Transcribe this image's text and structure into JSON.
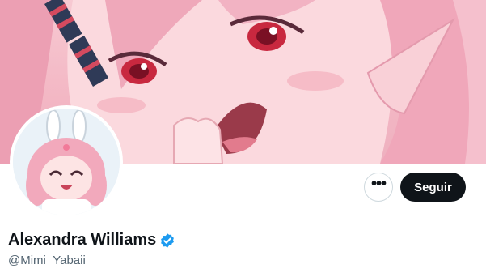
{
  "header": {
    "banner_icon": "anime-character-banner",
    "avatar_icon": "chibi-bunny-avatar"
  },
  "actions": {
    "more_icon": "more-horizontal-icon",
    "more_label": "•••",
    "follow_label": "Seguir"
  },
  "profile": {
    "display_name": "Alexandra Williams",
    "verified_icon": "verified-badge-icon",
    "handle": "@Mimi_Yabaii"
  },
  "colors": {
    "follow_bg": "#0f1419",
    "verified": "#1d9bf0",
    "handle": "#536471"
  }
}
